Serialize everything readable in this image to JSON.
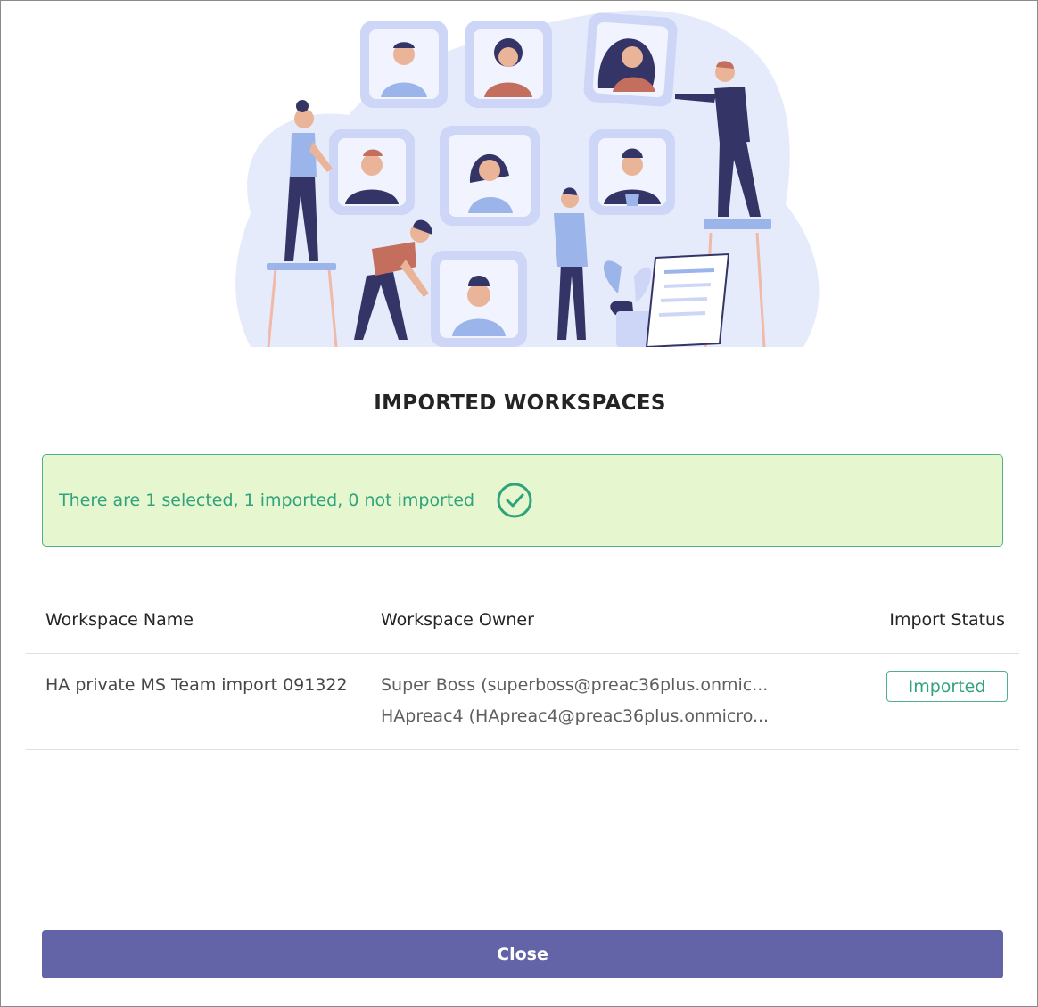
{
  "dialog": {
    "title": "IMPORTED WORKSPACES",
    "banner": {
      "message": "There are 1 selected, 1 imported, 0 not imported",
      "icon": "check-circle-icon"
    },
    "table": {
      "headers": {
        "name": "Workspace Name",
        "owner": "Workspace Owner",
        "status": "Import Status"
      },
      "rows": [
        {
          "name": "HA private MS Team import 091322",
          "owners": [
            "Super Boss (superboss@preac36plus.onmic...",
            "HApreac4 (HApreac4@preac36plus.onmicro..."
          ],
          "status": "Imported"
        }
      ]
    },
    "close_label": "Close"
  },
  "colors": {
    "accent": "#6264a7",
    "success_text": "#2fa37a",
    "success_border": "#4fb08a",
    "success_bg": "#e6f7d0"
  }
}
